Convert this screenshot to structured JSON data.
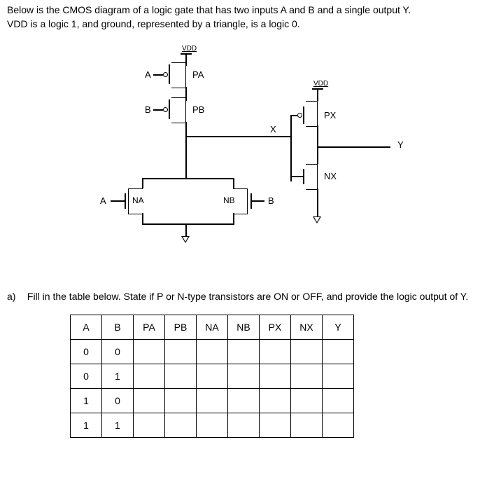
{
  "intro_line1": "Below is the CMOS diagram of a logic gate that has two inputs A and B and a single output Y.",
  "intro_line2": "VDD is a logic 1, and ground, represented by a triangle, is a logic 0.",
  "labels": {
    "vdd1": "VDD",
    "vdd2": "VDD",
    "A_pa": "A",
    "PA": "PA",
    "B_pb": "B",
    "PB": "PB",
    "X": "X",
    "PX": "PX",
    "Y": "Y",
    "NX": "NX",
    "A_na": "A",
    "NA": "NA",
    "NB": "NB",
    "B_nb": "B"
  },
  "question_a": "Fill in the table below.  State if P or N-type transistors are ON or OFF, and provide the logic output of Y.",
  "table": {
    "headers": [
      "A",
      "B",
      "PA",
      "PB",
      "NA",
      "NB",
      "PX",
      "NX",
      "Y"
    ],
    "rows": [
      [
        "0",
        "0",
        "",
        "",
        "",
        "",
        "",
        "",
        ""
      ],
      [
        "0",
        "1",
        "",
        "",
        "",
        "",
        "",
        "",
        ""
      ],
      [
        "1",
        "0",
        "",
        "",
        "",
        "",
        "",
        "",
        ""
      ],
      [
        "1",
        "1",
        "",
        "",
        "",
        "",
        "",
        "",
        ""
      ]
    ]
  },
  "chart_data": {
    "type": "table",
    "description": "CMOS logic gate truth table to be filled in",
    "inputs": [
      "A",
      "B"
    ],
    "transistors": [
      "PA",
      "PB",
      "NA",
      "NB",
      "PX",
      "NX"
    ],
    "output": "Y",
    "circuit": {
      "pmos_network": "PA and PB in series from VDD to node X (inputs A, B)",
      "nmos_network": "NA and NB in parallel from node X to ground (inputs A, B)",
      "output_stage": "PX (pmos, gate=X) from VDD to Y; NX (nmos, gate=X) from Y to ground"
    },
    "input_rows": [
      [
        0,
        0
      ],
      [
        0,
        1
      ],
      [
        1,
        0
      ],
      [
        1,
        1
      ]
    ]
  }
}
